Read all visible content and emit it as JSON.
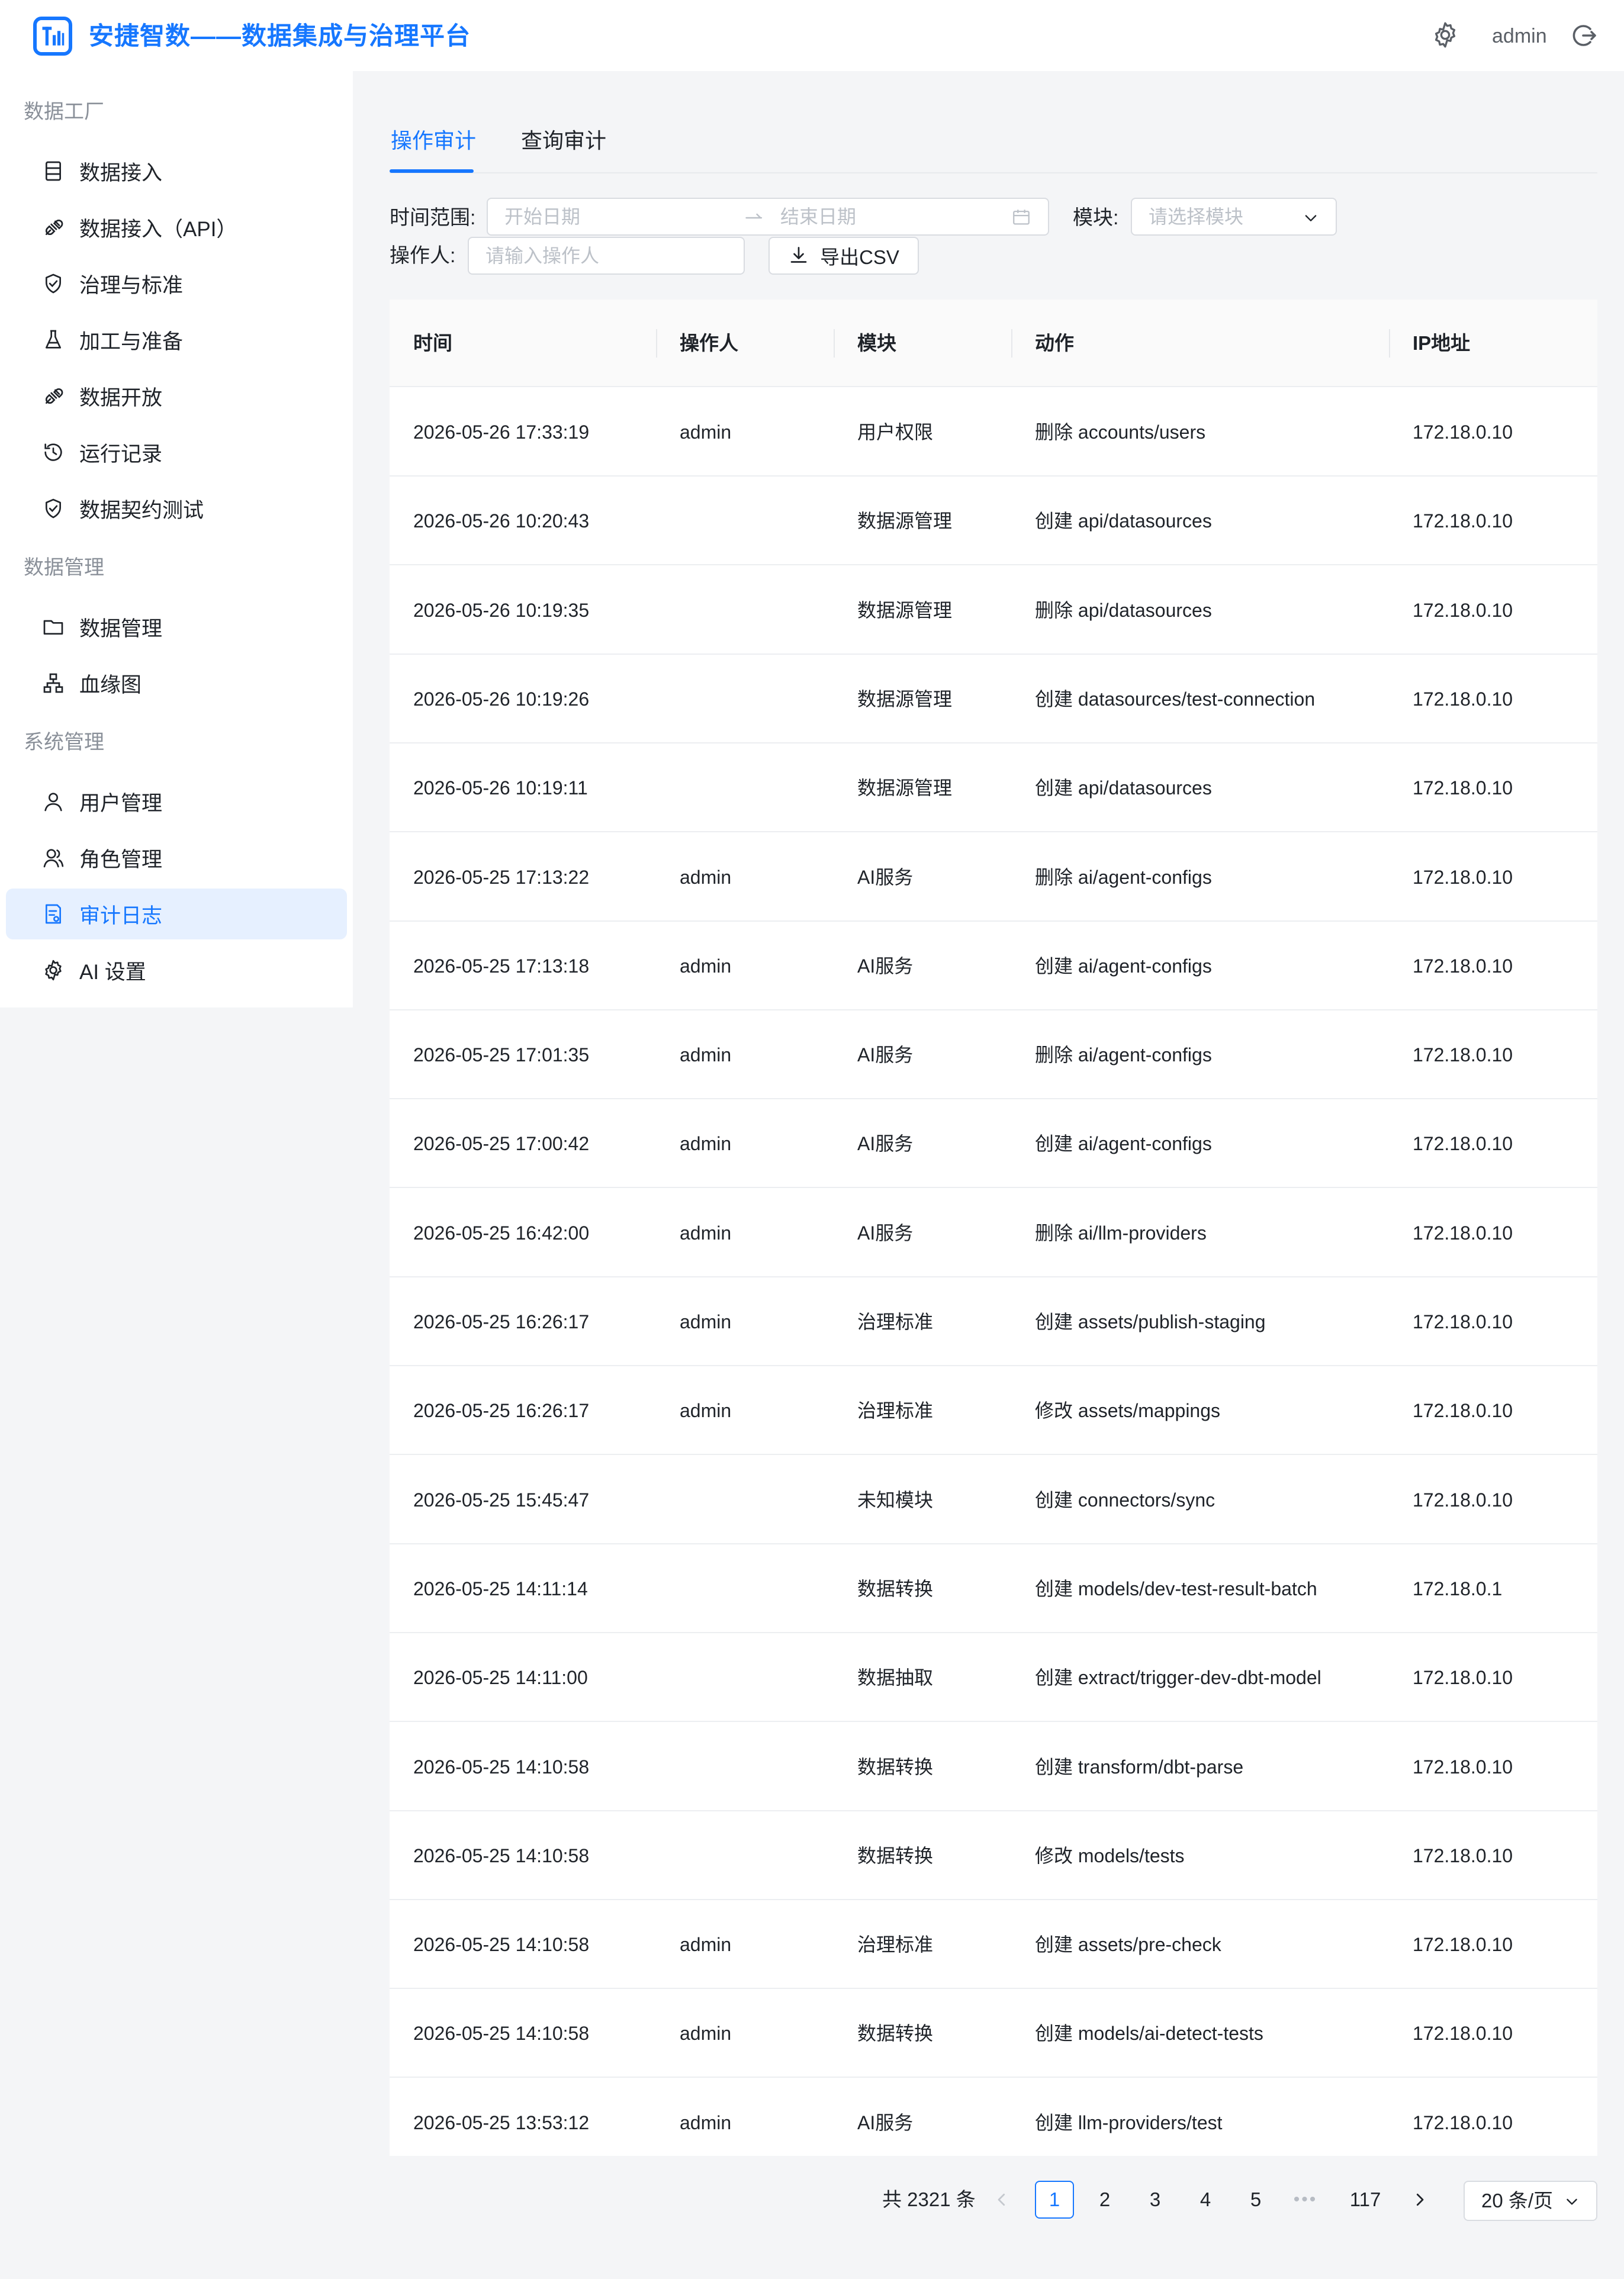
{
  "header": {
    "title": "安捷智数——数据集成与治理平台",
    "user": "admin",
    "brand_color": "#1677ff",
    "icons": [
      "logo-icon",
      "gear-icon",
      "logout-icon"
    ]
  },
  "sidebar": {
    "groups": [
      {
        "label": "数据工厂"
      },
      {
        "label": "数据管理"
      },
      {
        "label": "系统管理"
      }
    ],
    "items": [
      {
        "label": "数据接入",
        "icon": "database-icon"
      },
      {
        "label": "数据接入（API）",
        "icon": "plug-icon"
      },
      {
        "label": "治理与标准",
        "icon": "shield-check-icon"
      },
      {
        "label": "加工与准备",
        "icon": "flask-icon"
      },
      {
        "label": "数据开放",
        "icon": "plug-icon"
      },
      {
        "label": "运行记录",
        "icon": "history-icon"
      },
      {
        "label": "数据契约测试",
        "icon": "shield-check-icon"
      },
      {
        "label": "数据管理",
        "icon": "folder-icon"
      },
      {
        "label": "血缘图",
        "icon": "lineage-icon"
      },
      {
        "label": "用户管理",
        "icon": "user-icon"
      },
      {
        "label": "角色管理",
        "icon": "users-icon"
      },
      {
        "label": "审计日志",
        "icon": "audit-icon",
        "active": true
      },
      {
        "label": "AI 设置",
        "icon": "gear-icon"
      }
    ]
  },
  "tabs": [
    {
      "label": "操作审计",
      "active": true
    },
    {
      "label": "查询审计",
      "active": false
    }
  ],
  "filters": {
    "time_label": "时间范围:",
    "start_placeholder": "开始日期",
    "end_placeholder": "结束日期",
    "module_label": "模块:",
    "module_placeholder": "请选择模块",
    "operator_label": "操作人:",
    "operator_placeholder": "请输入操作人",
    "export_label": "导出CSV"
  },
  "table": {
    "columns": [
      "时间",
      "操作人",
      "模块",
      "动作",
      "IP地址"
    ],
    "rows": [
      {
        "time": "2026-05-26 17:33:19",
        "operator": "admin",
        "module": "用户权限",
        "action": "删除 accounts/users",
        "ip": "172.18.0.10"
      },
      {
        "time": "2026-05-26 10:20:43",
        "operator": "",
        "module": "数据源管理",
        "action": "创建 api/datasources",
        "ip": "172.18.0.10"
      },
      {
        "time": "2026-05-26 10:19:35",
        "operator": "",
        "module": "数据源管理",
        "action": "删除 api/datasources",
        "ip": "172.18.0.10"
      },
      {
        "time": "2026-05-26 10:19:26",
        "operator": "",
        "module": "数据源管理",
        "action": "创建 datasources/test-connection",
        "ip": "172.18.0.10"
      },
      {
        "time": "2026-05-26 10:19:11",
        "operator": "",
        "module": "数据源管理",
        "action": "创建 api/datasources",
        "ip": "172.18.0.10"
      },
      {
        "time": "2026-05-25 17:13:22",
        "operator": "admin",
        "module": "AI服务",
        "action": "删除 ai/agent-configs",
        "ip": "172.18.0.10"
      },
      {
        "time": "2026-05-25 17:13:18",
        "operator": "admin",
        "module": "AI服务",
        "action": "创建 ai/agent-configs",
        "ip": "172.18.0.10"
      },
      {
        "time": "2026-05-25 17:01:35",
        "operator": "admin",
        "module": "AI服务",
        "action": "删除 ai/agent-configs",
        "ip": "172.18.0.10"
      },
      {
        "time": "2026-05-25 17:00:42",
        "operator": "admin",
        "module": "AI服务",
        "action": "创建 ai/agent-configs",
        "ip": "172.18.0.10"
      },
      {
        "time": "2026-05-25 16:42:00",
        "operator": "admin",
        "module": "AI服务",
        "action": "删除 ai/llm-providers",
        "ip": "172.18.0.10"
      },
      {
        "time": "2026-05-25 16:26:17",
        "operator": "admin",
        "module": "治理标准",
        "action": "创建 assets/publish-staging",
        "ip": "172.18.0.10"
      },
      {
        "time": "2026-05-25 16:26:17",
        "operator": "admin",
        "module": "治理标准",
        "action": "修改 assets/mappings",
        "ip": "172.18.0.10"
      },
      {
        "time": "2026-05-25 15:45:47",
        "operator": "",
        "module": "未知模块",
        "action": "创建 connectors/sync",
        "ip": "172.18.0.10"
      },
      {
        "time": "2026-05-25 14:11:14",
        "operator": "",
        "module": "数据转换",
        "action": "创建 models/dev-test-result-batch",
        "ip": "172.18.0.1"
      },
      {
        "time": "2026-05-25 14:11:00",
        "operator": "",
        "module": "数据抽取",
        "action": "创建 extract/trigger-dev-dbt-model",
        "ip": "172.18.0.10"
      },
      {
        "time": "2026-05-25 14:10:58",
        "operator": "",
        "module": "数据转换",
        "action": "创建 transform/dbt-parse",
        "ip": "172.18.0.10"
      },
      {
        "time": "2026-05-25 14:10:58",
        "operator": "",
        "module": "数据转换",
        "action": "修改 models/tests",
        "ip": "172.18.0.10"
      },
      {
        "time": "2026-05-25 14:10:58",
        "operator": "admin",
        "module": "治理标准",
        "action": "创建 assets/pre-check",
        "ip": "172.18.0.10"
      },
      {
        "time": "2026-05-25 14:10:58",
        "operator": "admin",
        "module": "数据转换",
        "action": "创建 models/ai-detect-tests",
        "ip": "172.18.0.10"
      },
      {
        "time": "2026-05-25 13:53:12",
        "operator": "admin",
        "module": "AI服务",
        "action": "创建 llm-providers/test",
        "ip": "172.18.0.10"
      }
    ]
  },
  "pagination": {
    "total": "共 2321 条",
    "pages": [
      "1",
      "2",
      "3",
      "4",
      "5"
    ],
    "ellipsis": "•••",
    "last_page": "117",
    "current": "1",
    "page_size": "20 条/页"
  }
}
